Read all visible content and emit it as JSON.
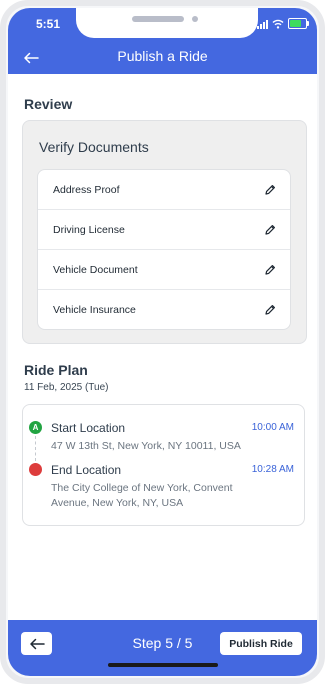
{
  "status_bar": {
    "time": "5:51"
  },
  "header": {
    "title": "Publish a Ride"
  },
  "review": {
    "section_title": "Review",
    "verify_title": "Verify Documents",
    "documents": [
      {
        "label": "Address Proof"
      },
      {
        "label": "Driving License"
      },
      {
        "label": "Vehicle Document"
      },
      {
        "label": "Vehicle Insurance"
      }
    ]
  },
  "ride_plan": {
    "section_title": "Ride Plan",
    "date": "11 Feb, 2025 (Tue)",
    "start": {
      "badge": "A",
      "name": "Start Location",
      "address": "47 W 13th St, New York, NY 10011, USA",
      "time": "10:00 AM"
    },
    "end": {
      "name": "End Location",
      "address": "The City College of New York, Convent Avenue, New York, NY, USA",
      "time": "10:28 AM"
    }
  },
  "footer": {
    "step": "Step 5 / 5",
    "publish_label": "Publish Ride"
  },
  "colors": {
    "primary": "#4468e0",
    "start_green": "#22a442",
    "end_red": "#dd3c3c",
    "time_blue": "#3a63d8"
  }
}
